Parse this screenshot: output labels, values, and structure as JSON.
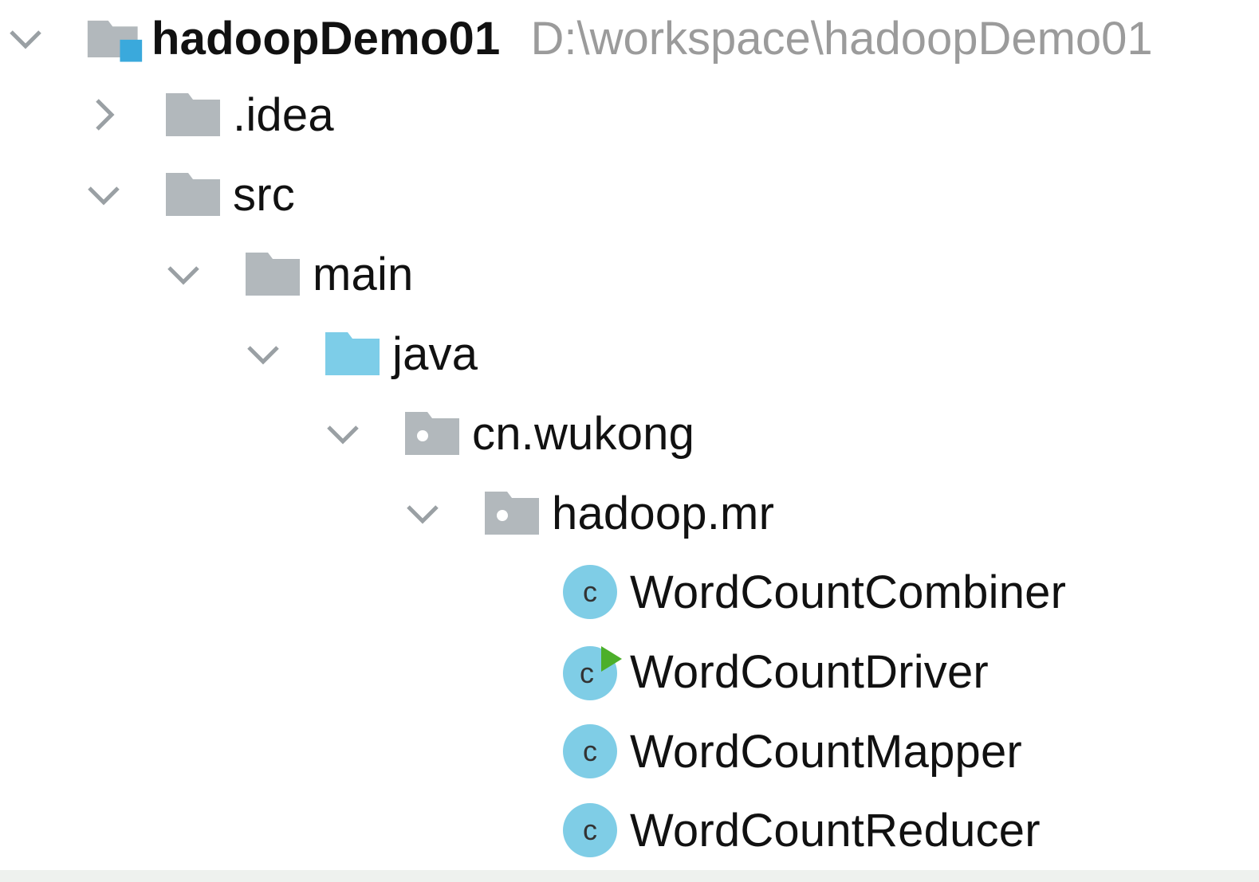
{
  "project_tree": {
    "root": {
      "name": "hadoopDemo01",
      "path": "D:\\workspace\\hadoopDemo01"
    },
    "items": [
      {
        "label": ".idea",
        "icon": "folder-icon",
        "expanded": false
      },
      {
        "label": "src",
        "icon": "folder-icon",
        "expanded": true
      },
      {
        "label": "main",
        "icon": "folder-icon",
        "expanded": true
      },
      {
        "label": "java",
        "icon": "source-root-folder-icon",
        "expanded": true
      },
      {
        "label": "cn.wukong",
        "icon": "package-icon",
        "expanded": true
      },
      {
        "label": "hadoop.mr",
        "icon": "package-icon",
        "expanded": true
      }
    ],
    "classes": [
      {
        "label": "WordCountCombiner",
        "icon": "java-class-icon",
        "runnable": false
      },
      {
        "label": "WordCountDriver",
        "icon": "java-class-run-icon",
        "runnable": true
      },
      {
        "label": "WordCountMapper",
        "icon": "java-class-icon",
        "runnable": false
      },
      {
        "label": "WordCountReducer",
        "icon": "java-class-icon",
        "runnable": false
      }
    ],
    "class_icon_letter": "c"
  },
  "colors": {
    "folder": "#b2b8bc",
    "source_folder": "#7dcde8",
    "module_badge": "#3aa9dc",
    "class_circle": "#7fcde6",
    "run_arrow": "#4caf2a",
    "chevron": "#9aa0a4",
    "path_text": "#9b9b9b"
  }
}
